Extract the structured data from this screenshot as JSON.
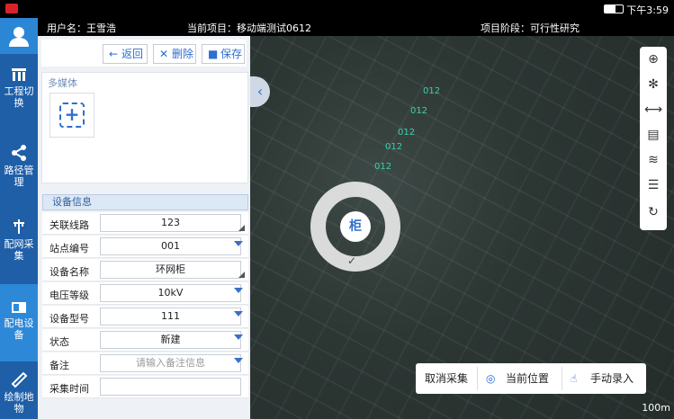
{
  "status_bar": {
    "time": "下午3:59"
  },
  "header": {
    "user": "用户名：王雪浩",
    "project": "当前项目：移动端测试0612",
    "stage": "项目阶段：可行性研究"
  },
  "nav": {
    "items": [
      {
        "label": "工程切换",
        "icon": "building-icon"
      },
      {
        "label": "路径管理",
        "icon": "share-icon"
      },
      {
        "label": "配网采集",
        "icon": "pole-icon"
      },
      {
        "label": "配电设备",
        "icon": "device-icon"
      },
      {
        "label": "绘制地物",
        "icon": "ruler-icon"
      }
    ]
  },
  "toolbar": {
    "back": "返回",
    "delete": "删除",
    "save": "保存"
  },
  "media": {
    "title": "多媒体"
  },
  "device_info": {
    "title": "设备信息",
    "fields": [
      {
        "label": "关联线路",
        "value": "123"
      },
      {
        "label": "站点编号",
        "value": "001"
      },
      {
        "label": "设备名称",
        "value": "环网柜"
      },
      {
        "label": "电压等级",
        "value": "10kV"
      },
      {
        "label": "设备型号",
        "value": "111"
      },
      {
        "label": "状态",
        "value": "新建"
      },
      {
        "label": "备注",
        "placeholder": "请输入备注信息"
      },
      {
        "label": "采集时间",
        "value": ""
      }
    ]
  },
  "map": {
    "pins": [
      "012",
      "012",
      "012",
      "012",
      "012"
    ],
    "ring_label": "柜",
    "actions": {
      "cancel": "取消采集",
      "current": "当前位置",
      "manual": "手动录入"
    },
    "scale": "100m"
  }
}
